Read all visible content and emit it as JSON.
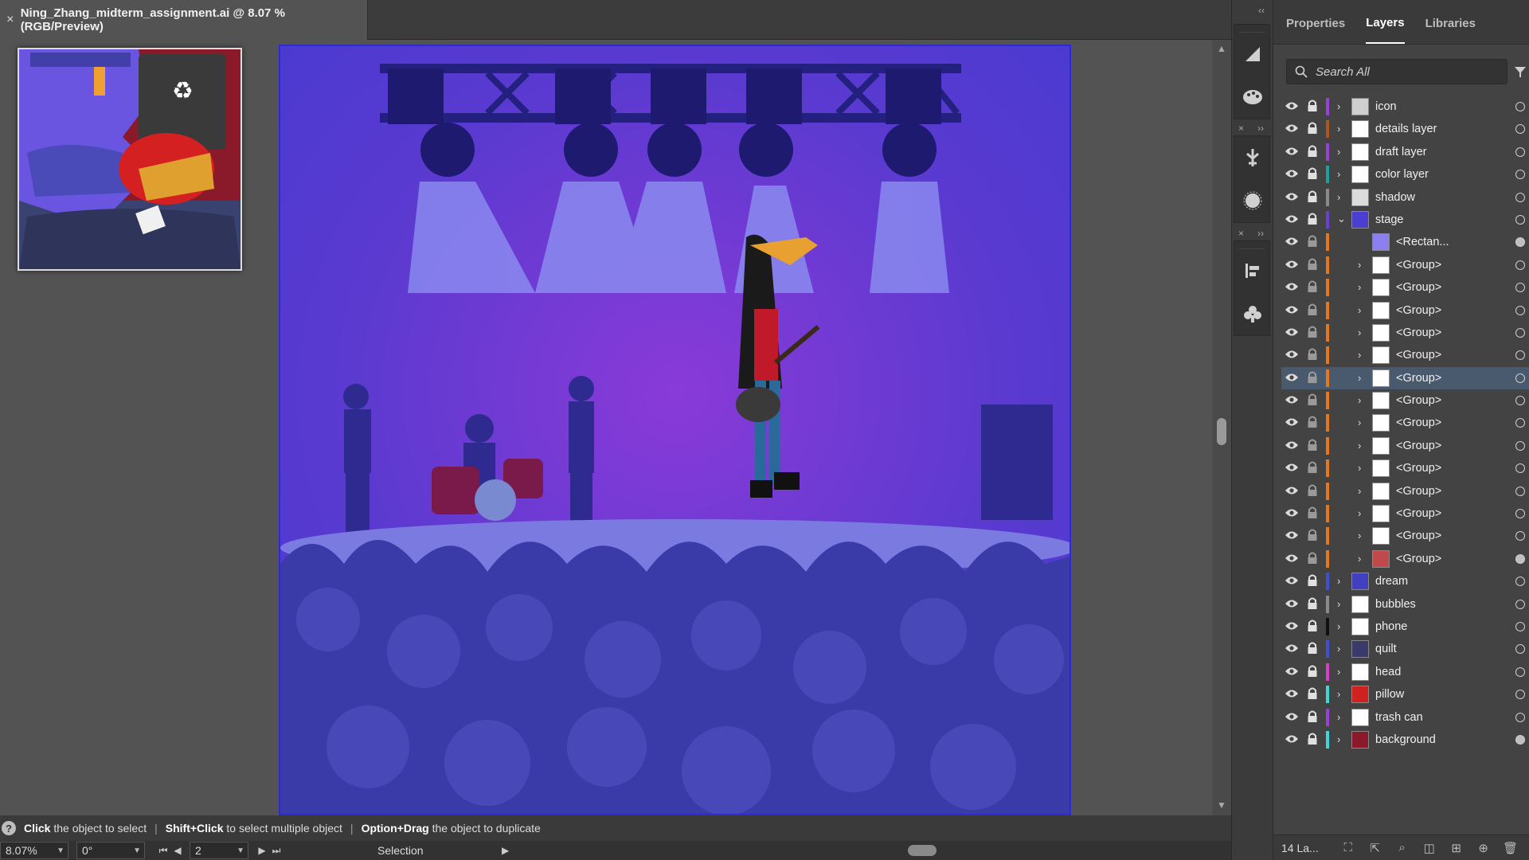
{
  "document": {
    "close_glyph": "×",
    "tab_title": "Ning_Zhang_midterm_assignment.ai @ 8.07 % (RGB/Preview)"
  },
  "status": {
    "help_glyph": "?",
    "hint1_bold": "Click",
    "hint1_text": "the object to select",
    "sep": "|",
    "hint2_bold": "Shift+Click",
    "hint2_text": "to select multiple object",
    "hint3_bold": "Option+Drag",
    "hint3_text": "the object to duplicate"
  },
  "bottom": {
    "zoom": "8.07%",
    "rotation": "0°",
    "artboard_number": "2",
    "mode": "Selection"
  },
  "panel": {
    "tabs": [
      "Properties",
      "Layers",
      "Libraries"
    ],
    "active_tab": "Layers",
    "search_placeholder": "Search All",
    "footer_count": "14 La..."
  },
  "layers": [
    {
      "name": "icon",
      "level": 0,
      "color": "#9b3fd8",
      "thumb": "#cfcfcf"
    },
    {
      "name": "details layer",
      "level": 0,
      "color": "#b0551d",
      "thumb": "#ffffff"
    },
    {
      "name": "draft layer",
      "level": 0,
      "color": "#9b3fd8",
      "thumb": "#ffffff"
    },
    {
      "name": "color layer",
      "level": 0,
      "color": "#1f9fa0",
      "thumb": "#ffffff"
    },
    {
      "name": "shadow",
      "level": 0,
      "color": "#8a8a8a",
      "thumb": "#dcdcdc"
    },
    {
      "name": "stage",
      "level": 0,
      "color": "#6b3fd8",
      "thumb": "#4a3fd0",
      "expanded": true
    },
    {
      "name": "<Rectan...",
      "level": 1,
      "color": "#e8761b",
      "thumb": "#8c80f0"
    },
    {
      "name": "<Group>",
      "level": 1,
      "color": "#e8761b",
      "thumb": "#ffffff"
    },
    {
      "name": "<Group>",
      "level": 1,
      "color": "#e8761b",
      "thumb": "#ffffff"
    },
    {
      "name": "<Group>",
      "level": 1,
      "color": "#e8761b",
      "thumb": "#ffffff"
    },
    {
      "name": "<Group>",
      "level": 1,
      "color": "#e8761b",
      "thumb": "#ffffff"
    },
    {
      "name": "<Group>",
      "level": 1,
      "color": "#e8761b",
      "thumb": "#ffffff"
    },
    {
      "name": "<Group>",
      "level": 1,
      "color": "#e8761b",
      "thumb": "#ffffff",
      "selected": true
    },
    {
      "name": "<Group>",
      "level": 1,
      "color": "#e8761b",
      "thumb": "#ffffff"
    },
    {
      "name": "<Group>",
      "level": 1,
      "color": "#e8761b",
      "thumb": "#ffffff"
    },
    {
      "name": "<Group>",
      "level": 1,
      "color": "#e8761b",
      "thumb": "#ffffff"
    },
    {
      "name": "<Group>",
      "level": 1,
      "color": "#e8761b",
      "thumb": "#ffffff"
    },
    {
      "name": "<Group>",
      "level": 1,
      "color": "#e8761b",
      "thumb": "#ffffff"
    },
    {
      "name": "<Group>",
      "level": 1,
      "color": "#e8761b",
      "thumb": "#ffffff"
    },
    {
      "name": "<Group>",
      "level": 1,
      "color": "#e8761b",
      "thumb": "#ffffff"
    },
    {
      "name": "<Group>",
      "level": 1,
      "color": "#e8761b",
      "thumb": "#c04a4a"
    },
    {
      "name": "dream",
      "level": 0,
      "color": "#3f4fd8",
      "thumb": "#4040c0"
    },
    {
      "name": "bubbles",
      "level": 0,
      "color": "#8a8a8a",
      "thumb": "#ffffff"
    },
    {
      "name": "phone",
      "level": 0,
      "color": "#111111",
      "thumb": "#ffffff"
    },
    {
      "name": "quilt",
      "level": 0,
      "color": "#3f4fd8",
      "thumb": "#3a3a6a"
    },
    {
      "name": "head",
      "level": 0,
      "color": "#d83fc8",
      "thumb": "#ffffff"
    },
    {
      "name": "pillow",
      "level": 0,
      "color": "#3fd8d8",
      "thumb": "#d02020"
    },
    {
      "name": "trash can",
      "level": 0,
      "color": "#9b3fd8",
      "thumb": "#ffffff"
    },
    {
      "name": "background",
      "level": 0,
      "color": "#3fd8d8",
      "thumb": "#8a1a2a"
    }
  ],
  "colors": {
    "selection": "#4a5a6e",
    "artboard_border": "#2b2bd0",
    "scene_purple": "#6a3ad8",
    "crowd": "#3a3aa8"
  },
  "icons": {
    "eye": "eye-icon",
    "lock": "lock-icon",
    "expand": "chevron-right-icon",
    "recycle": "♻"
  }
}
